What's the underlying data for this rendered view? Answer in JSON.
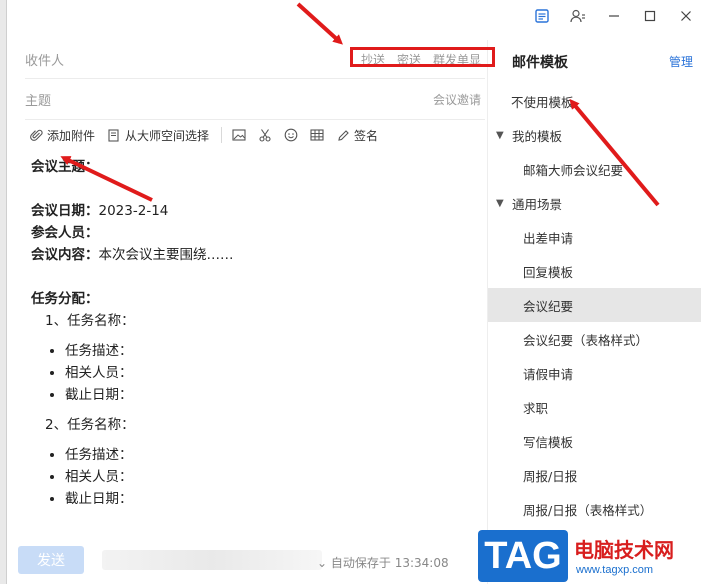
{
  "titlebar": {
    "icons": [
      "mail-template-icon",
      "contacts-icon",
      "minimize-icon",
      "maximize-icon",
      "close-icon"
    ]
  },
  "compose": {
    "to_placeholder": "收件人",
    "cc_label": "抄送",
    "bcc_label": "密送",
    "group_send_label": "群发单显",
    "subject_placeholder": "主题",
    "meeting_invite_label": "会议邀请",
    "toolbar": {
      "attach_label": "添加附件",
      "from_master_label": "从大师空间选择",
      "signature_label": "签名"
    }
  },
  "body": {
    "topic_label": "会议主题：",
    "date_label": "会议日期：",
    "date_value": "2023-2-14",
    "attendees_label": "参会人员：",
    "content_label": "会议内容：",
    "content_value": "本次会议主要围绕……",
    "tasks_label": "任务分配：",
    "task1": "1、任务名称：",
    "task1_items": [
      "任务描述：",
      "相关人员：",
      "截止日期："
    ],
    "task2": "2、任务名称：",
    "task2_items": [
      "任务描述：",
      "相关人员：",
      "截止日期："
    ]
  },
  "bottom": {
    "send_label": "发送",
    "autosave": "自动保存于 13:34:08"
  },
  "panel": {
    "title": "邮件模板",
    "manage": "管理",
    "no_template": "不使用模板",
    "my_templates": "我的模板",
    "my_items": [
      "邮箱大师会议纪要"
    ],
    "common": "通用场景",
    "common_items": [
      "出差申请",
      "回复模板",
      "会议纪要",
      "会议纪要（表格样式）",
      "请假申请",
      "求职",
      "写信模板",
      "周报/日报",
      "周报/日报（表格样式）"
    ],
    "active_item": "会议纪要"
  },
  "colors": {
    "accent": "#2a73d9",
    "annotation": "#e01b1b",
    "send_disabled": "#c8dcf7",
    "active_bg": "#e6e6e6"
  },
  "watermark": {
    "tag": "TAG",
    "site_name": "电脑技术网",
    "url": "www.tagxp.com"
  }
}
